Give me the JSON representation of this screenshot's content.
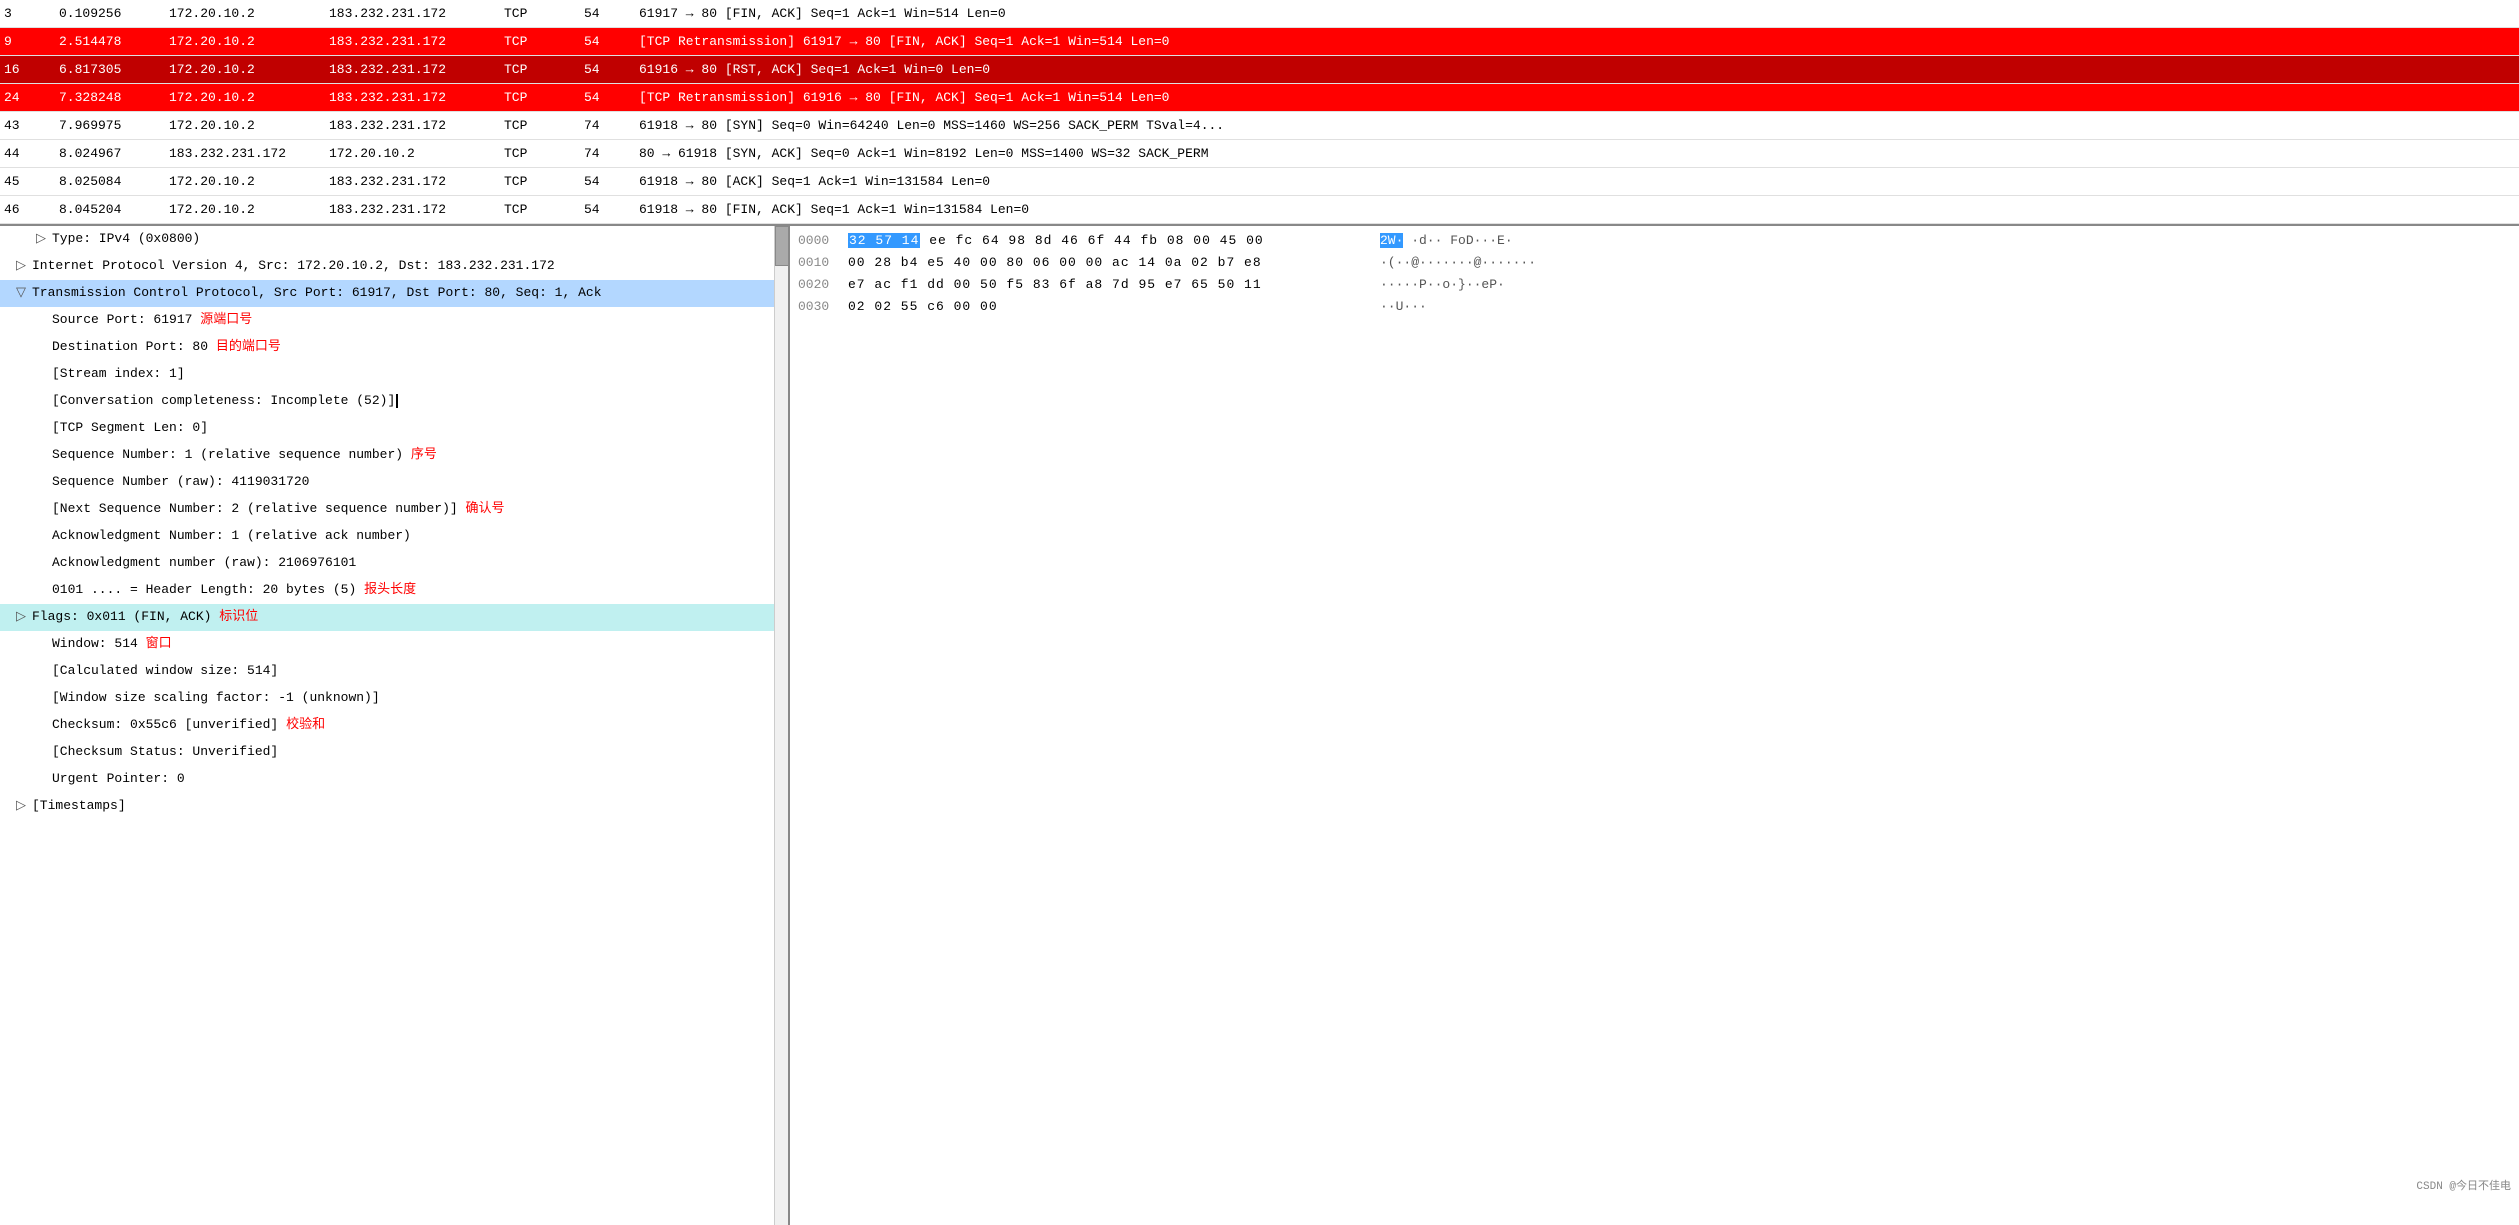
{
  "packetList": {
    "rows": [
      {
        "no": "3",
        "time": "0.109256",
        "src": "172.20.10.2",
        "dst": "183.232.231.172",
        "proto": "TCP",
        "len": "54",
        "info": "61917 → 80 [FIN, ACK] Seq=1 Ack=1 Win=514 Len=0",
        "style": "normal"
      },
      {
        "no": "9",
        "time": "2.514478",
        "src": "172.20.10.2",
        "dst": "183.232.231.172",
        "proto": "TCP",
        "len": "54",
        "info": "[TCP Retransmission] 61917 → 80 [FIN, ACK] Seq=1 Ack=1 Win=514 Len=0",
        "style": "selected-red"
      },
      {
        "no": "16",
        "time": "6.817305",
        "src": "172.20.10.2",
        "dst": "183.232.231.172",
        "proto": "TCP",
        "len": "54",
        "info": "61916 → 80 [RST, ACK] Seq=1 Ack=1 Win=0 Len=0",
        "style": "selected-dark-red"
      },
      {
        "no": "24",
        "time": "7.328248",
        "src": "172.20.10.2",
        "dst": "183.232.231.172",
        "proto": "TCP",
        "len": "54",
        "info": "[TCP Retransmission] 61916 → 80 [FIN, ACK] Seq=1 Ack=1 Win=514 Len=0",
        "style": "selected-red"
      },
      {
        "no": "43",
        "time": "7.969975",
        "src": "172.20.10.2",
        "dst": "183.232.231.172",
        "proto": "TCP",
        "len": "74",
        "info": "61918 → 80 [SYN] Seq=0 Win=64240 Len=0 MSS=1460 WS=256 SACK_PERM TSval=4...",
        "style": "normal"
      },
      {
        "no": "44",
        "time": "8.024967",
        "src": "183.232.231.172",
        "dst": "172.20.10.2",
        "proto": "TCP",
        "len": "74",
        "info": "80 → 61918 [SYN, ACK] Seq=0 Ack=1 Win=8192 Len=0 MSS=1400 WS=32 SACK_PERM",
        "style": "normal"
      },
      {
        "no": "45",
        "time": "8.025084",
        "src": "172.20.10.2",
        "dst": "183.232.231.172",
        "proto": "TCP",
        "len": "54",
        "info": "61918 → 80 [ACK] Seq=1 Ack=1 Win=131584 Len=0",
        "style": "normal"
      },
      {
        "no": "46",
        "time": "8.045204",
        "src": "172.20.10.2",
        "dst": "183.232.231.172",
        "proto": "TCP",
        "len": "54",
        "info": "61918 → 80 [FIN, ACK] Seq=1 Ack=1 Win=131584 Len=0",
        "style": "normal"
      }
    ]
  },
  "detailPanel": {
    "rows": [
      {
        "indent": 1,
        "arrow": "▷",
        "text": "Type: IPv4 (0x0800)",
        "style": "normal"
      },
      {
        "indent": 0,
        "arrow": "▷",
        "text": "Internet Protocol Version 4, Src: 172.20.10.2, Dst: 183.232.231.172",
        "style": "normal"
      },
      {
        "indent": 0,
        "arrow": "▽",
        "text": "Transmission Control Protocol, Src Port: 61917, Dst Port: 80, Seq: 1, Ack",
        "style": "selected-blue"
      },
      {
        "indent": 1,
        "arrow": "",
        "text": "Source Port: 61917",
        "annotation": "源端口号",
        "annotationColor": "red",
        "style": "normal"
      },
      {
        "indent": 1,
        "arrow": "",
        "text": "Destination Port: 80",
        "annotation": "目的端口号",
        "annotationColor": "red",
        "style": "normal"
      },
      {
        "indent": 1,
        "arrow": "",
        "text": "[Stream index: 1]",
        "style": "normal"
      },
      {
        "indent": 1,
        "arrow": "",
        "text": "[Conversation completeness: Incomplete (52)]",
        "style": "normal",
        "cursor": true
      },
      {
        "indent": 1,
        "arrow": "",
        "text": "[TCP Segment Len: 0]",
        "style": "normal"
      },
      {
        "indent": 1,
        "arrow": "",
        "text": "Sequence Number: 1    (relative sequence number)",
        "annotation": "序号",
        "annotationColor": "red",
        "style": "normal"
      },
      {
        "indent": 1,
        "arrow": "",
        "text": "Sequence Number (raw): 4119031720",
        "style": "normal"
      },
      {
        "indent": 1,
        "arrow": "",
        "text": "[Next Sequence Number: 2    (relative sequence number)]",
        "annotation": "确认号",
        "annotationColor": "red",
        "style": "normal"
      },
      {
        "indent": 1,
        "arrow": "",
        "text": "Acknowledgment Number: 1    (relative ack number)",
        "style": "normal"
      },
      {
        "indent": 1,
        "arrow": "",
        "text": "Acknowledgment number (raw): 2106976101",
        "style": "normal"
      },
      {
        "indent": 1,
        "arrow": "",
        "text": "0101 .... = Header Length: 20 bytes (5)",
        "annotation": "报头长度",
        "annotationColor": "red",
        "style": "normal"
      },
      {
        "indent": 0,
        "arrow": "▷",
        "text": "Flags: 0x011 (FIN, ACK)",
        "annotation": "标识位",
        "annotationColor": "red",
        "style": "selected-cyan"
      },
      {
        "indent": 1,
        "arrow": "",
        "text": "Window: 514",
        "annotation": "窗口",
        "annotationColor": "red",
        "style": "normal"
      },
      {
        "indent": 1,
        "arrow": "",
        "text": "[Calculated window size: 514]",
        "style": "normal"
      },
      {
        "indent": 1,
        "arrow": "",
        "text": "[Window size scaling factor: -1 (unknown)]",
        "style": "normal"
      },
      {
        "indent": 1,
        "arrow": "",
        "text": "Checksum: 0x55c6 [unverified]",
        "annotation": "校验和",
        "annotationColor": "red",
        "style": "normal"
      },
      {
        "indent": 1,
        "arrow": "",
        "text": "[Checksum Status: Unverified]",
        "style": "normal"
      },
      {
        "indent": 1,
        "arrow": "",
        "text": "Urgent Pointer: 0",
        "style": "normal"
      },
      {
        "indent": 0,
        "arrow": "▷",
        "text": "[Timestamps]",
        "style": "normal"
      }
    ]
  },
  "hexPanel": {
    "rows": [
      {
        "offset": "0000",
        "bytes": "32 57 14 ee fc 64 98 8d   46 6f 44 fb 08 00 45 00",
        "highlight": "32 57 14",
        "ascii": "2W·  ·d··  FoD···E·",
        "highlightAscii": "2W·"
      },
      {
        "offset": "0010",
        "bytes": "00 28 b4 e5 40 00 80 06   00 00 ac 14 0a 02 b7 e8",
        "ascii": "·(··@·······@·······"
      },
      {
        "offset": "0020",
        "bytes": "e7 ac f1 dd 00 50 f5 83   6f a8 7d 95 e7 65 50 11",
        "ascii": "·····P··o·}··eP·"
      },
      {
        "offset": "0030",
        "bytes": "02 02 55 c6 00 00",
        "ascii": "··U···"
      }
    ]
  },
  "statusBar": {
    "text": "CSDN @今日不佳电"
  }
}
